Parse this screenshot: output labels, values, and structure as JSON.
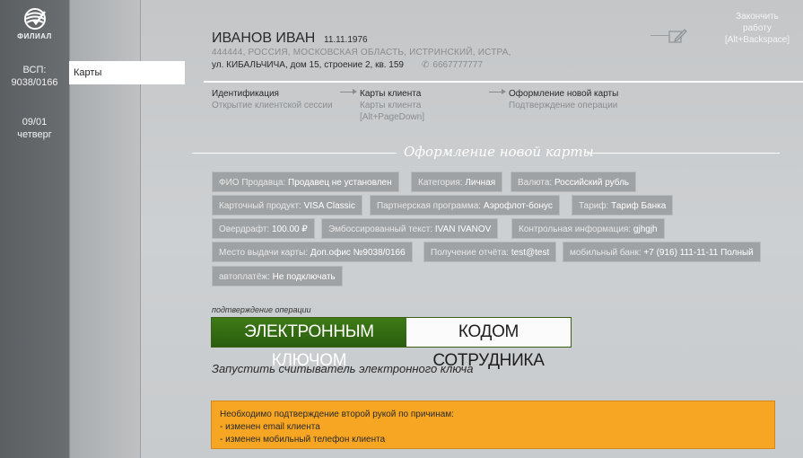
{
  "sidebar": {
    "logo_text": "ФИЛИАЛ",
    "vsp_label": "ВСП:",
    "vsp_value": "9038/0166",
    "date": "09/01",
    "weekday": "четверг"
  },
  "nav": {
    "active_item": "Карты"
  },
  "client": {
    "name": "ИВАНОВ ИВАН",
    "dob": "11.11.1976",
    "address_line1": "444444, РОССИЯ, МОСКОВСКАЯ ОБЛАСТЬ, ИСТРИНСКИЙ, ИСТРА,",
    "address_line2": "ул. КИБАЛЬЧИЧА, дом 15, строение 2, кв. 159",
    "phone": "6667777777"
  },
  "header": {
    "finish_line1": "Закончить",
    "finish_line2": "работу",
    "finish_hotkey": "[Alt+Backspace]"
  },
  "steps": [
    {
      "title": "Идентификация",
      "subtitle": "Открытие клиентской сессии",
      "hotkey": ""
    },
    {
      "title": "Карты клиента",
      "subtitle": "Карты клиента",
      "hotkey": "[Alt+PageDown]"
    },
    {
      "title": "Оформление новой карты",
      "subtitle": "Подтверждение операции",
      "hotkey": ""
    }
  ],
  "section_title": "Оформление новой карты",
  "details": [
    {
      "label": "ФИО Продавца:",
      "value": "Продавец не установлен"
    },
    {
      "label": "Категория:",
      "value": "Личная"
    },
    {
      "label": "Валюта:",
      "value": "Российский рубль"
    },
    {
      "label": "Карточный продукт:",
      "value": "VISA Classic"
    },
    {
      "label": "Партнерская программа:",
      "value": "Аэрофлот-бонус"
    },
    {
      "label": "Тариф:",
      "value": "Тариф Банка"
    },
    {
      "label": "Овердрафт:",
      "value": "100.00 ₽"
    },
    {
      "label": "Эмбоссированный текст:",
      "value": "IVAN IVANOV"
    },
    {
      "label": "Контрольная информация:",
      "value": "gjhgjh"
    },
    {
      "label": "Место выдачи карты:",
      "value": "Доп.офис №9038/0166"
    },
    {
      "label": "Получение отчёта:",
      "value": "test@test"
    },
    {
      "label": "мобильный банк:",
      "value": "+7 (916) 111-11-11 Полный"
    },
    {
      "label": "автоплатёж:",
      "value": "Не подключать"
    }
  ],
  "confirm": {
    "label": "подтверждение операции",
    "by_key": "ЭЛЕКТРОННЫМ КЛЮЧОМ",
    "by_employee": "КОДОМ СОТРУДНИКА",
    "run_reader": "Запустить считыватель электронного ключа"
  },
  "warning": {
    "title": "Необходимо подтверждение второй рукой по причинам:",
    "items": [
      "- изменен email клиента",
      "- изменен мобильный телефон клиента"
    ]
  },
  "colors": {
    "rail": "#63676a",
    "accent_green": "#2f6a10",
    "warning_orange": "#f6a623"
  }
}
